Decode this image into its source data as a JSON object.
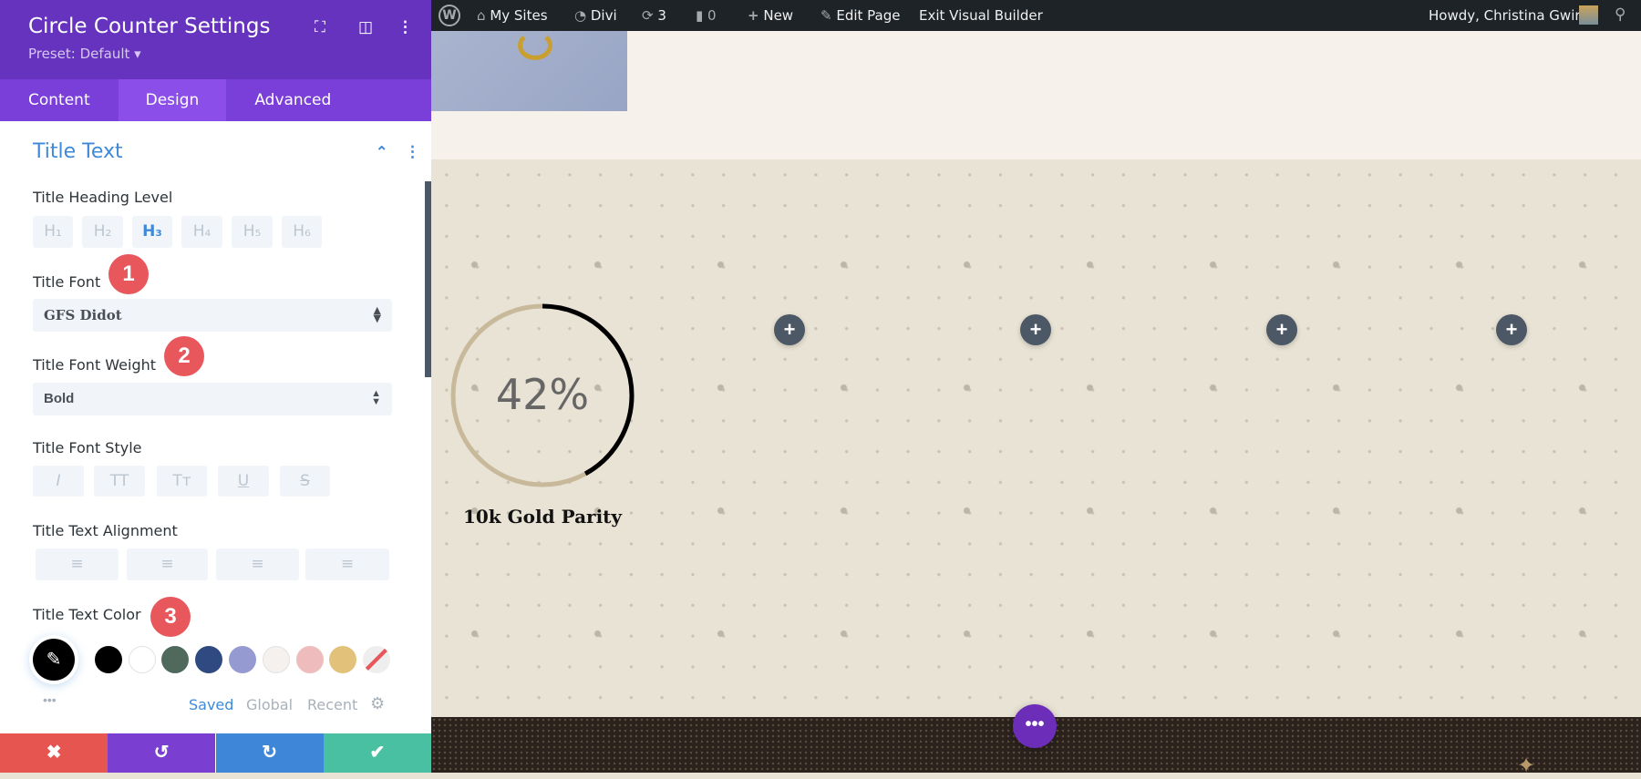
{
  "panel": {
    "title": "Circle Counter Settings",
    "preset": "Preset: Default ▾",
    "tabs": [
      "Content",
      "Design",
      "Advanced"
    ],
    "section": "Title Text",
    "heading_level": {
      "label": "Title Heading Level",
      "options": [
        "H₁",
        "H₂",
        "H₃",
        "H₄",
        "H₅",
        "H₆"
      ],
      "selected": "H₃"
    },
    "font": {
      "label": "Title Font",
      "value": "GFS Didot"
    },
    "weight": {
      "label": "Title Font Weight",
      "value": "Bold"
    },
    "style": {
      "label": "Title Font Style",
      "options": [
        "I",
        "TT",
        "Tт",
        "U",
        "S"
      ]
    },
    "align": {
      "label": "Title Text Alignment"
    },
    "color": {
      "label": "Title Text Color",
      "current": "#000000",
      "swatches": [
        "#000000",
        "#ffffff",
        "#4f6a5c",
        "#2f4a80",
        "#959bd1",
        "#f5f1ee",
        "#efbcbd",
        "#e2c27a"
      ],
      "tabs": [
        "Saved",
        "Global",
        "Recent"
      ],
      "more": "•••"
    },
    "badges": [
      "1",
      "2",
      "3"
    ]
  },
  "adminbar": {
    "my_sites": "My Sites",
    "divi": "Divi",
    "updates": "3",
    "comments": "0",
    "new": "New",
    "edit": "Edit Page",
    "exit": "Exit Visual Builder",
    "howdy": "Howdy, Christina Gwira"
  },
  "counter": {
    "percent": 42,
    "label": "42%",
    "title": "10k Gold Parity"
  },
  "colors": {
    "accent": "#6533bd",
    "counter_bar": "#000000",
    "counter_track": "#c8b99b"
  }
}
